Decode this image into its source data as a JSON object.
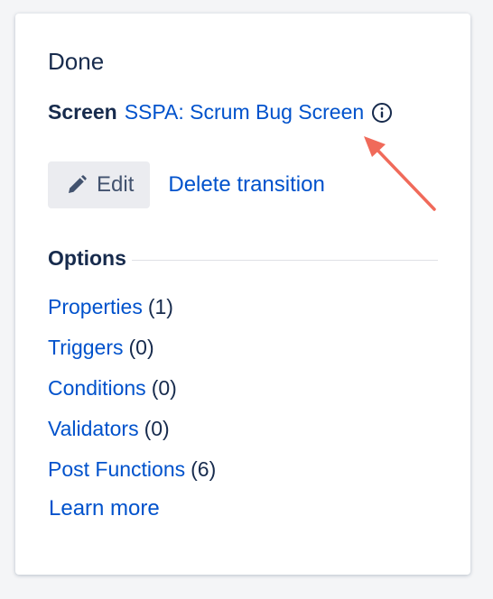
{
  "transition": {
    "title": "Done",
    "screen_label": "Screen",
    "screen_name": "SSPA: Scrum Bug Screen",
    "info_icon": "info-circle-icon"
  },
  "actions": {
    "edit_label": "Edit",
    "edit_icon": "pencil-icon",
    "delete_label": "Delete transition"
  },
  "options": {
    "title": "Options",
    "items": [
      {
        "label": "Properties",
        "count": "(1)"
      },
      {
        "label": "Triggers",
        "count": "(0)"
      },
      {
        "label": "Conditions",
        "count": "(0)"
      },
      {
        "label": "Validators",
        "count": "(0)"
      },
      {
        "label": "Post Functions",
        "count": "(6)"
      }
    ],
    "learn_more": "Learn more"
  },
  "annotation": {
    "arrow_color": "#f06a5a"
  },
  "colors": {
    "link": "#0052cc",
    "text": "#172b4d",
    "button_bg": "#ebecf0"
  }
}
